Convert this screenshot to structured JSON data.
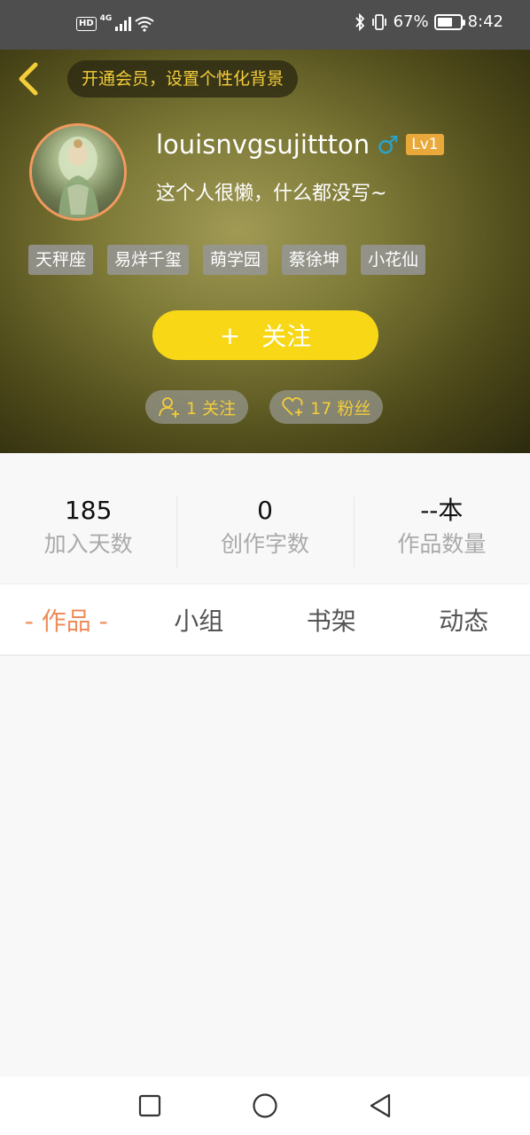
{
  "status_bar": {
    "hd": "HD",
    "network": "4G",
    "battery_percent": "67%",
    "battery_level": 0.67,
    "time": "8:42"
  },
  "header": {
    "vip_prompt": "开通会员，设置个性化背景",
    "username": "louisnvgsujittton",
    "gender_symbol": "♂",
    "level": "Lv1",
    "bio": "这个人很懒，什么都没写~",
    "tags": [
      "天秤座",
      "易烊千玺",
      "萌学园",
      "蔡徐坤",
      "小花仙"
    ],
    "follow_button": {
      "plus": "+",
      "label": "关注"
    },
    "following": "1 关注",
    "followers": "17 粉丝"
  },
  "stats": [
    {
      "value": "185",
      "label": "加入天数"
    },
    {
      "value": "0",
      "label": "创作字数"
    },
    {
      "value": "--本",
      "label": "作品数量"
    }
  ],
  "tabs": [
    {
      "label": "- 作品 -",
      "active": true
    },
    {
      "label": "小组",
      "active": false
    },
    {
      "label": "书架",
      "active": false
    },
    {
      "label": "动态",
      "active": false
    }
  ],
  "icons": {
    "back": "chevron-left-icon",
    "following": "user-add-icon",
    "followers": "heart-plus-icon",
    "nav": [
      "square-icon",
      "circle-icon",
      "triangle-back-icon"
    ]
  },
  "colors": {
    "accent_yellow": "#f7d716",
    "tab_active": "#ef8c5a",
    "gender_blue": "#29a3c9",
    "level_badge": "#e8a93a",
    "vip_text": "#f4cd3a"
  }
}
